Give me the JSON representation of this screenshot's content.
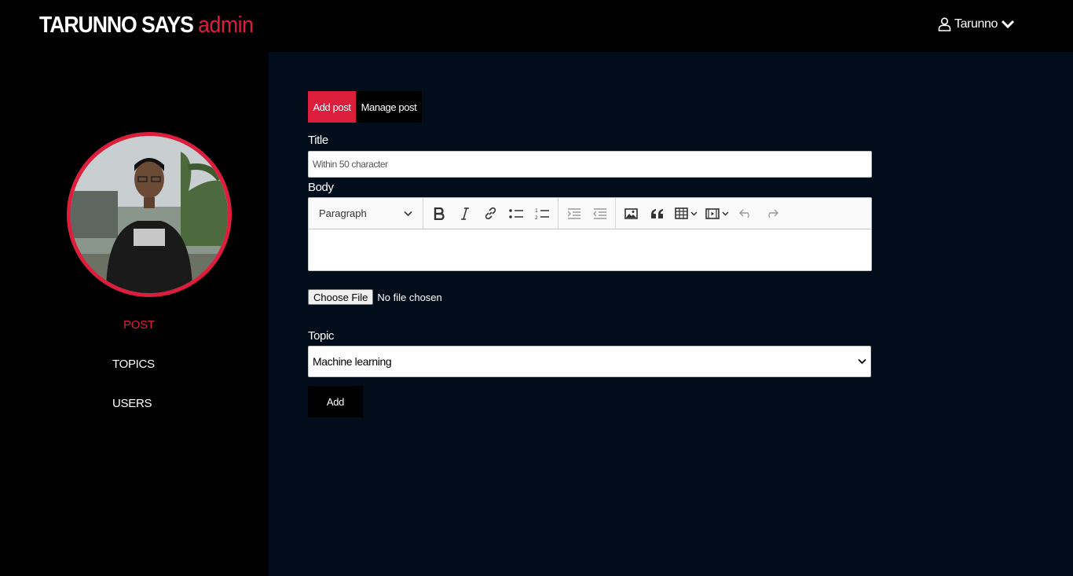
{
  "header": {
    "brand_main": "TARUNNO SAYS",
    "brand_accent": "admin",
    "user_name": "Tarunno"
  },
  "sidebar": {
    "items": [
      {
        "label": "POST",
        "active": true
      },
      {
        "label": "TOPICS",
        "active": false
      },
      {
        "label": "USERS",
        "active": false
      }
    ]
  },
  "tabs": [
    {
      "label": "Add post",
      "active": true
    },
    {
      "label": "Manage post",
      "active": false
    }
  ],
  "form": {
    "title_label": "Title",
    "title_placeholder": "Within 50 character",
    "body_label": "Body",
    "heading_select": "Paragraph",
    "file_button": "Choose File",
    "file_status": "No file chosen",
    "topic_label": "Topic",
    "topic_value": "Machine learning",
    "submit_label": "Add"
  },
  "toolbar_icons": [
    "bold-icon",
    "italic-icon",
    "link-icon",
    "bulleted-list-icon",
    "numbered-list-icon",
    "indent-icon",
    "outdent-icon",
    "image-icon",
    "blockquote-icon",
    "table-icon",
    "media-icon",
    "undo-icon",
    "redo-icon"
  ],
  "colors": {
    "accent": "#dc1e3c",
    "content_bg": "#010d1b",
    "sidebar_bg": "#000000"
  }
}
